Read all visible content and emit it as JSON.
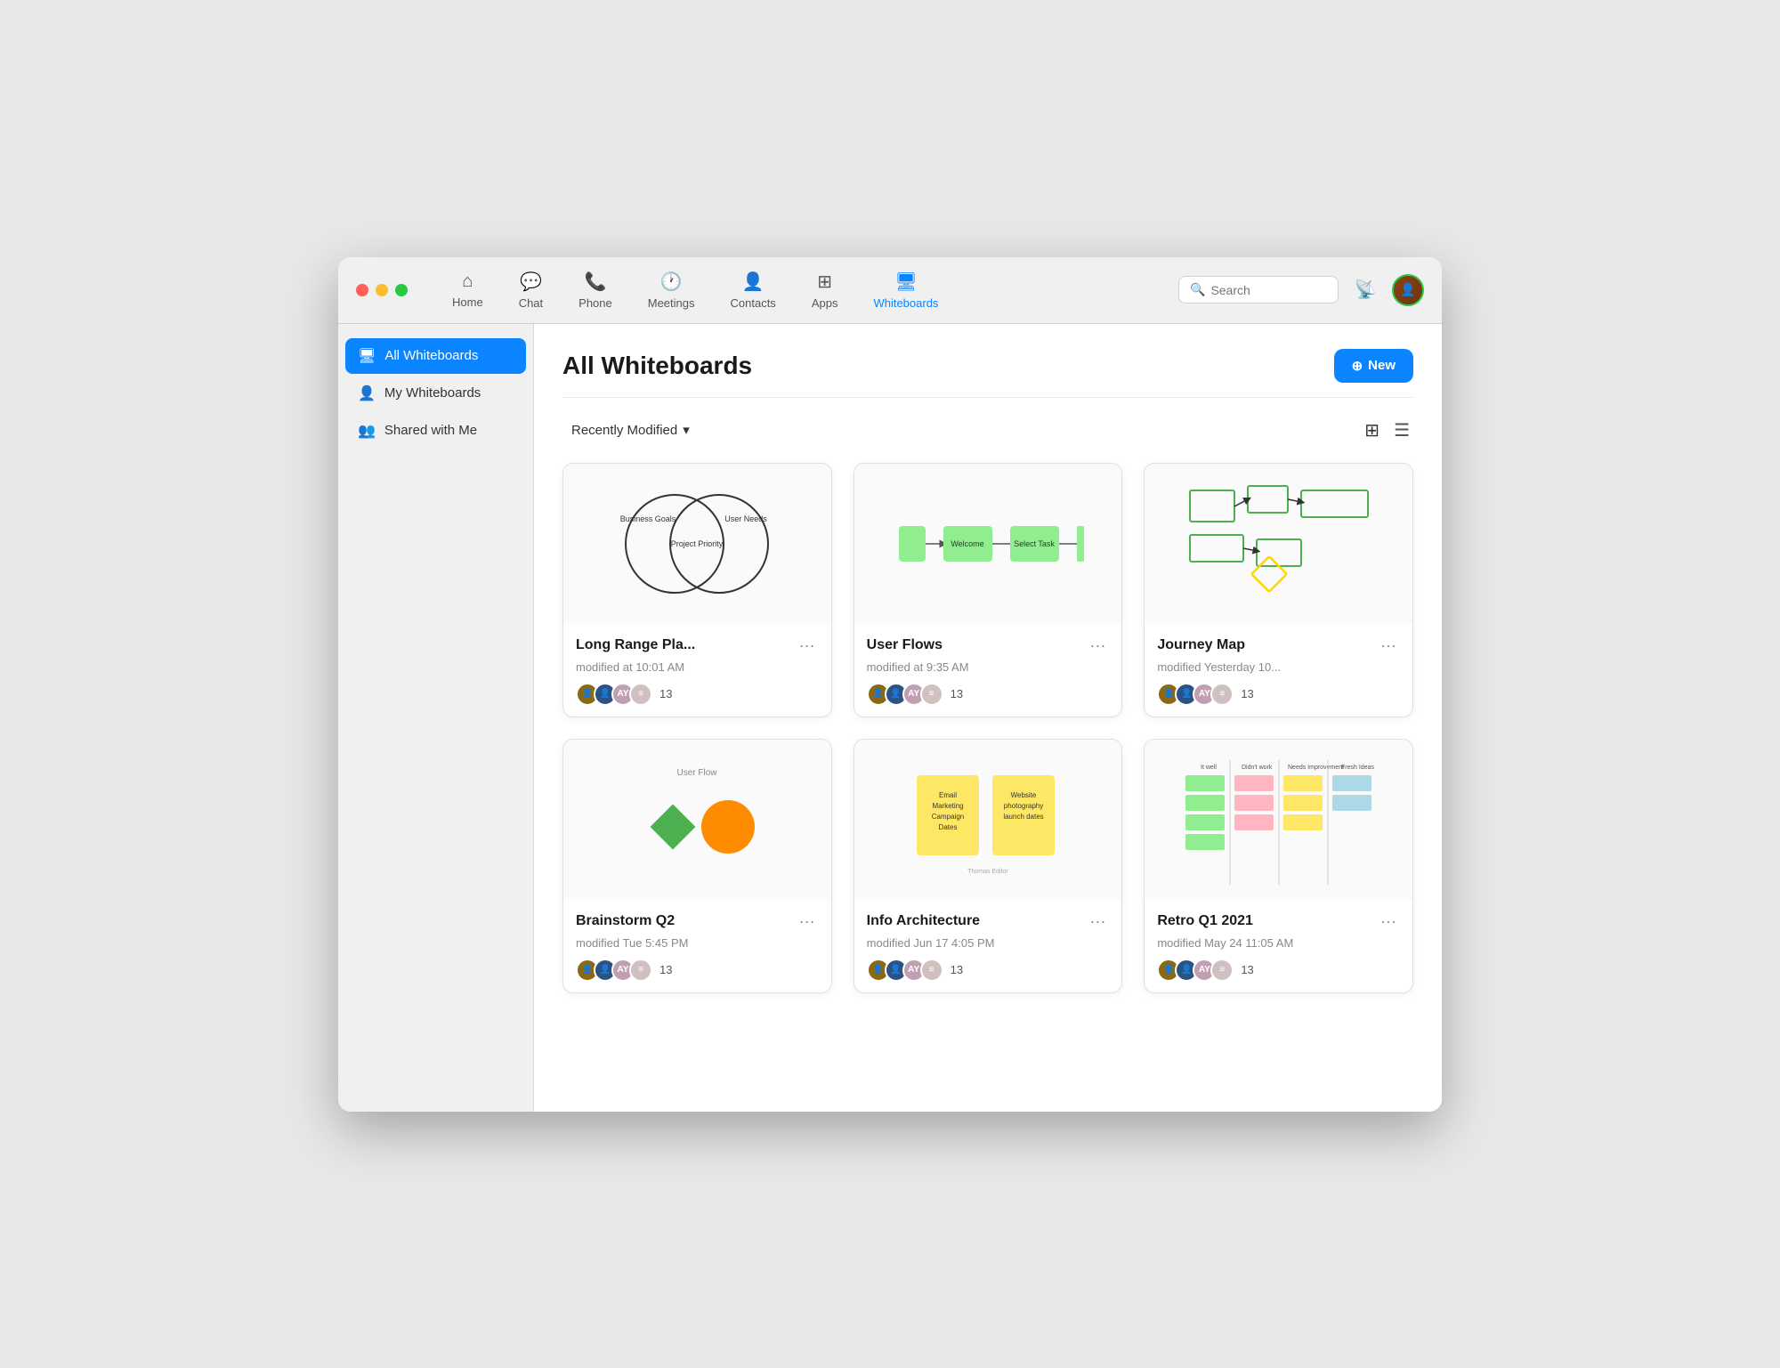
{
  "window": {
    "title": "Whiteboards"
  },
  "titlebar": {
    "traffic_lights": [
      "red",
      "yellow",
      "green"
    ]
  },
  "nav": {
    "items": [
      {
        "id": "home",
        "label": "Home",
        "icon": "🏠",
        "active": false
      },
      {
        "id": "chat",
        "label": "Chat",
        "icon": "💬",
        "active": false
      },
      {
        "id": "phone",
        "label": "Phone",
        "icon": "📞",
        "active": false
      },
      {
        "id": "meetings",
        "label": "Meetings",
        "icon": "🕐",
        "active": false
      },
      {
        "id": "contacts",
        "label": "Contacts",
        "icon": "👤",
        "active": false
      },
      {
        "id": "apps",
        "label": "Apps",
        "icon": "⊞",
        "active": false
      },
      {
        "id": "whiteboards",
        "label": "Whiteboards",
        "icon": "🖥",
        "active": true
      }
    ],
    "search_placeholder": "Search",
    "new_button_label": "New"
  },
  "sidebar": {
    "items": [
      {
        "id": "all",
        "label": "All Whiteboards",
        "icon": "🖥",
        "active": true
      },
      {
        "id": "my",
        "label": "My Whiteboards",
        "icon": "👤",
        "active": false
      },
      {
        "id": "shared",
        "label": "Shared with Me",
        "icon": "👥",
        "active": false
      }
    ]
  },
  "content": {
    "title": "All Whiteboards",
    "new_button": "+ New",
    "sort_label": "Recently Modified",
    "sort_icon": "▾",
    "whiteboards": [
      {
        "id": "long-range",
        "title": "Long Range Pla...",
        "modified": "modified at 10:01 AM",
        "participant_count": "13",
        "type": "venn"
      },
      {
        "id": "user-flows",
        "title": "User Flows",
        "modified": "modified at 9:35 AM",
        "participant_count": "13",
        "type": "flow"
      },
      {
        "id": "journey-map",
        "title": "Journey Map",
        "modified": "modified Yesterday 10...",
        "participant_count": "13",
        "type": "journey"
      },
      {
        "id": "brainstorm",
        "title": "Brainstorm Q2",
        "modified": "modified Tue 5:45 PM",
        "participant_count": "13",
        "type": "brainstorm"
      },
      {
        "id": "info-arch",
        "title": "Info Architecture",
        "modified": "modified Jun 17 4:05 PM",
        "participant_count": "13",
        "type": "info"
      },
      {
        "id": "retro",
        "title": "Retro Q1 2021",
        "modified": "modified May 24 11:05 AM",
        "participant_count": "13",
        "type": "retro"
      }
    ],
    "retro_columns": [
      "It well",
      "Didn't work",
      "Needs Improvement",
      "Fresh Ideas"
    ]
  },
  "colors": {
    "accent": "#0a84ff",
    "active_nav": "#0a84ff",
    "sidebar_active_bg": "#0a84ff"
  }
}
